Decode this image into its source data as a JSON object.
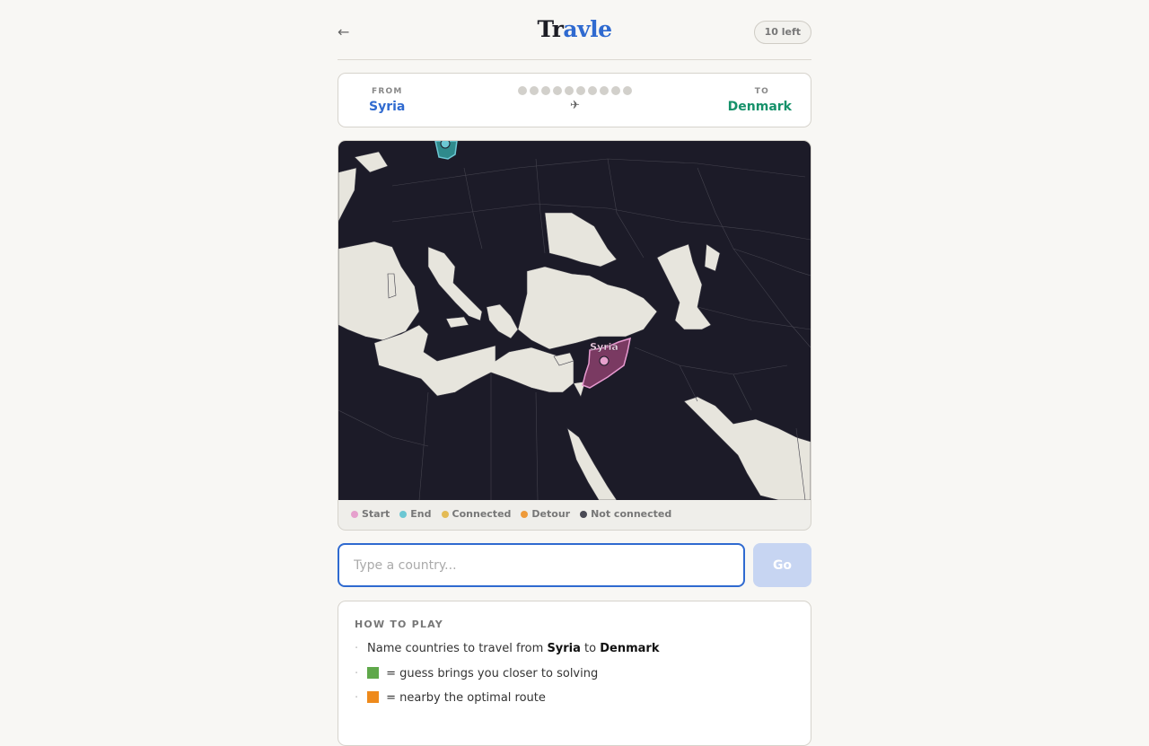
{
  "header": {
    "back_icon": "←",
    "logo_part1": "Tr",
    "logo_part2": "avle",
    "guesses_left": "10 left"
  },
  "route": {
    "from_label": "FROM",
    "from_country": "Syria",
    "to_label": "TO",
    "to_country": "Denmark",
    "plane_icon": "✈",
    "guess_slots": 10,
    "guesses_used": 0
  },
  "map": {
    "start_label": "Syria",
    "colors": {
      "water": "#1c1b28",
      "land": "#e7e5dd",
      "start": "#7a3a62",
      "start_stroke": "#e79ad0",
      "end": "#5ec7c4"
    }
  },
  "legend": [
    {
      "label": "Start",
      "color": "#e6a0cd"
    },
    {
      "label": "End",
      "color": "#6cc7d3"
    },
    {
      "label": "Connected",
      "color": "#e4bb55"
    },
    {
      "label": "Detour",
      "color": "#ee9a3a"
    },
    {
      "label": "Not connected",
      "color": "#4a4a55"
    }
  ],
  "input": {
    "placeholder": "Type a country...",
    "go_label": "Go"
  },
  "howto": {
    "title": "HOW TO PLAY",
    "line1_a": "Name countries to travel from ",
    "line1_from": "Syria",
    "line1_b": " to ",
    "line1_to": "Denmark",
    "line2": " = guess brings you closer to solving",
    "line2_color": "#5fa84a",
    "line3": " = nearby the optimal route",
    "line3_color": "#ee8a1c"
  }
}
